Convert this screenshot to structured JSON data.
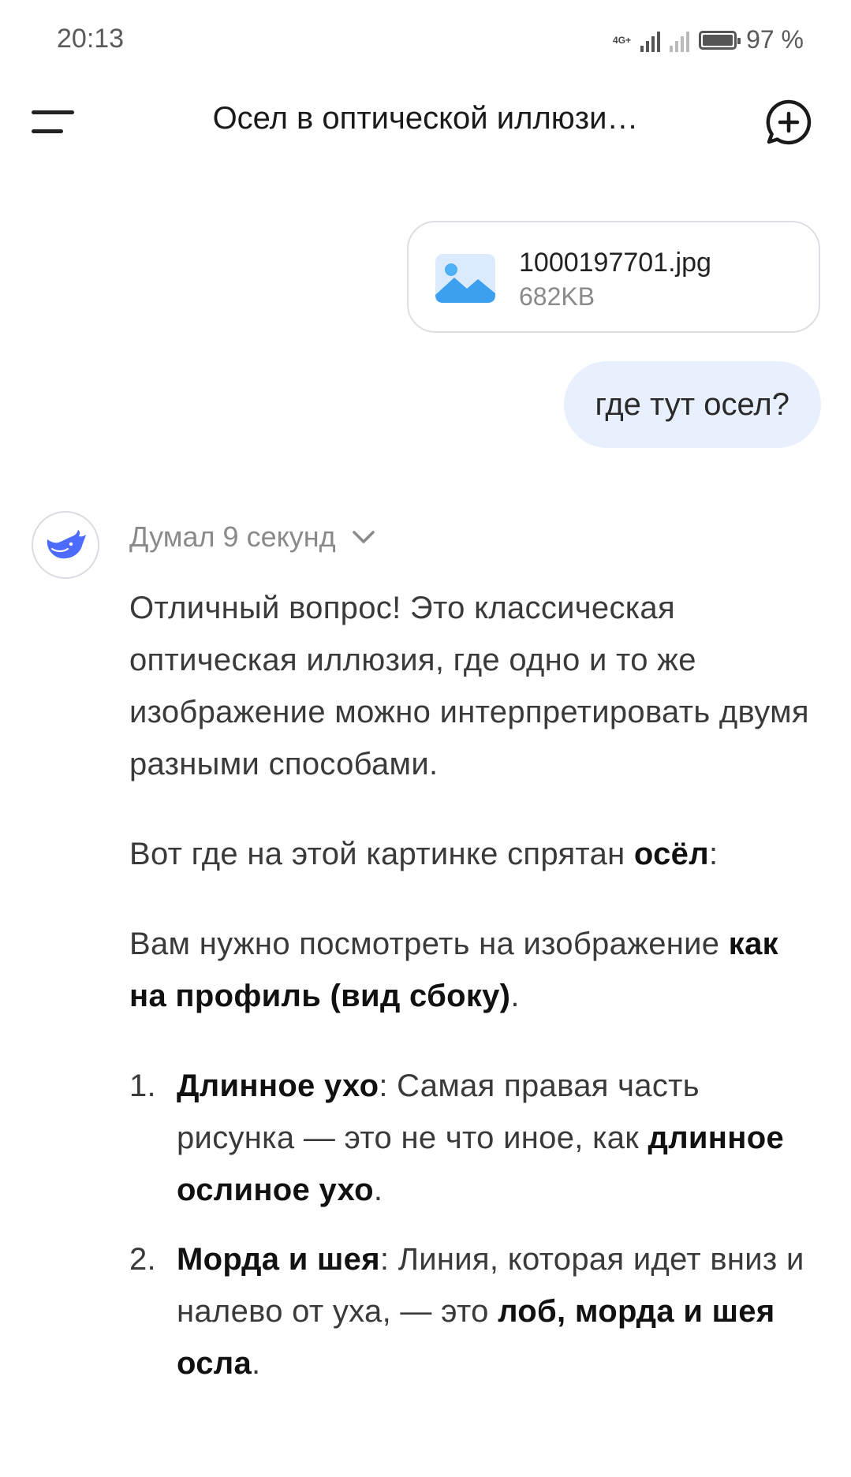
{
  "status": {
    "time": "20:13",
    "network": "4G+",
    "battery": "97 %"
  },
  "header": {
    "title": "Осел в оптической иллюзи…"
  },
  "attachment": {
    "filename": "1000197701.jpg",
    "size": "682KB"
  },
  "user_message": "где тут осел?",
  "assistant": {
    "thought_label": "Думал 9 секунд",
    "p1": "Отличный вопрос! Это классическая оптическая иллюзия, где одно и то же изображение можно интерпретировать двумя разными способами.",
    "p2_pre": "Вот где на этой картинке спрятан ",
    "p2_bold": "осёл",
    "p2_post": ":",
    "p3_pre": "Вам нужно посмотреть на изображение ",
    "p3_bold": "как на профиль (вид сбоку)",
    "p3_post": ".",
    "list": [
      {
        "num": "1.",
        "title": "Длинное ухо",
        "text": ": Самая правая часть рисунка — это не что иное, как ",
        "bold": "длинное ослиное ухо",
        "end": "."
      },
      {
        "num": "2.",
        "title": "Морда и шея",
        "text": ": Линия, которая идет вниз и налево от уха, — это ",
        "bold": "лоб, морда и шея осла",
        "end": "."
      }
    ]
  },
  "colors": {
    "user_bubble": "#e8f0fd",
    "brand_blue": "#4d6bfe",
    "muted_text": "#8a8a8a"
  }
}
